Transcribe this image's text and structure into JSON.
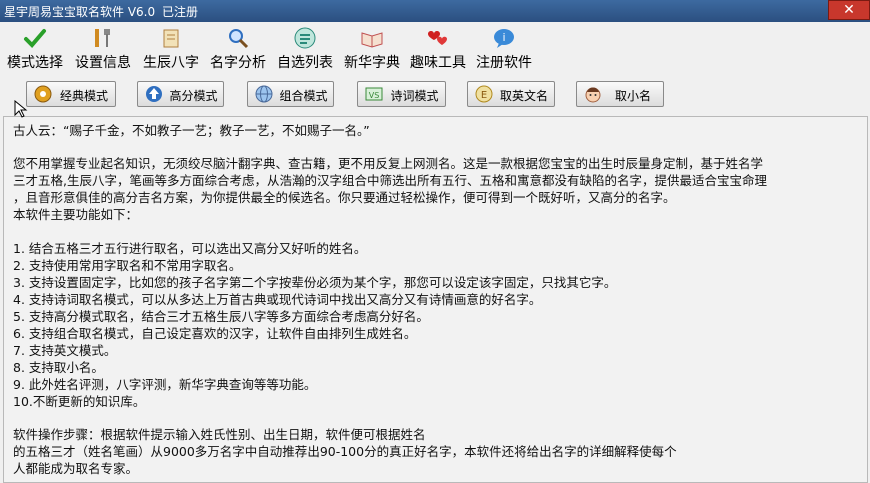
{
  "window": {
    "title": "星宇周易宝宝取名软件 V6.0",
    "status": "已注册",
    "close_glyph": "✕"
  },
  "toolbar": [
    {
      "label": "模式选择",
      "icon": "check-icon",
      "color": "#2aa02a"
    },
    {
      "label": "设置信息",
      "icon": "tools-icon",
      "color": "#d08a20"
    },
    {
      "label": "生辰八字",
      "icon": "scroll-icon",
      "color": "#b08040"
    },
    {
      "label": "名字分析",
      "icon": "magnifier-icon",
      "color": "#2f6fc0"
    },
    {
      "label": "自选列表",
      "icon": "list-icon",
      "color": "#2a8a7a"
    },
    {
      "label": "新华字典",
      "icon": "book-icon",
      "color": "#c05050"
    },
    {
      "label": "趣味工具",
      "icon": "hearts-icon",
      "color": "#d02020"
    },
    {
      "label": "注册软件",
      "icon": "chat-bubble-icon",
      "color": "#3a8ad8"
    }
  ],
  "modes": [
    {
      "label": "经典模式",
      "icon": "gear-icon"
    },
    {
      "label": "高分模式",
      "icon": "up-arrow-icon"
    },
    {
      "label": "组合模式",
      "icon": "globe-icon"
    },
    {
      "label": "诗词模式",
      "icon": "vs-icon"
    },
    {
      "label": "取英文名",
      "icon": "english-icon"
    },
    {
      "label": "取小名",
      "icon": "baby-icon"
    }
  ],
  "content": {
    "lines": [
      "古人云：“赐子千金，不如教子一艺；教子一艺，不如赐子一名。”",
      "",
      "您不用掌握专业起名知识，无须绞尽脑汁翻字典、查古籍，更不用反复上网测名。这是一款根据您宝宝的出生时辰量身定制，基于姓名学",
      "三才五格,生辰八字，笔画等多方面综合考虑，从浩瀚的汉字组合中筛选出所有五行、五格和寓意都没有缺陷的名字，提供最适合宝宝命理",
      "，且音形意俱佳的高分吉名方案，为你提供最全的候选名。你只要通过轻松操作，便可得到一个既好听，又高分的名字。",
      "本软件主要功能如下：",
      "",
      "1. 结合五格三才五行进行取名，可以选出又高分又好听的姓名。",
      "2. 支持使用常用字取名和不常用字取名。",
      "3. 支持设置固定字，比如您的孩子名字第二个字按辈份必须为某个字，那您可以设定该字固定，只找其它字。",
      "4. 支持诗词取名模式，可以从多达上万首古典或现代诗词中找出又高分又有诗情画意的好名字。",
      "5. 支持高分模式取名，结合三才五格生辰八字等多方面综合考虑高分好名。",
      "6. 支持组合取名模式，自己设定喜欢的汉字，让软件自由排列生成姓名。",
      "7. 支持英文模式。",
      "8. 支持取小名。",
      "9. 此外姓名评测，八字评测，新华字典查询等等功能。",
      "10.不断更新的知识库。",
      "",
      "软件操作步骤：根据软件提示输入姓氏性别、出生日期，软件便可根据姓名",
      "的五格三才（姓名笔画）从9000多万名字中自动推荐出90-100分的真正好名字，本软件还将给出名字的详细解释使每个",
      "人都能成为取名专家。"
    ]
  }
}
